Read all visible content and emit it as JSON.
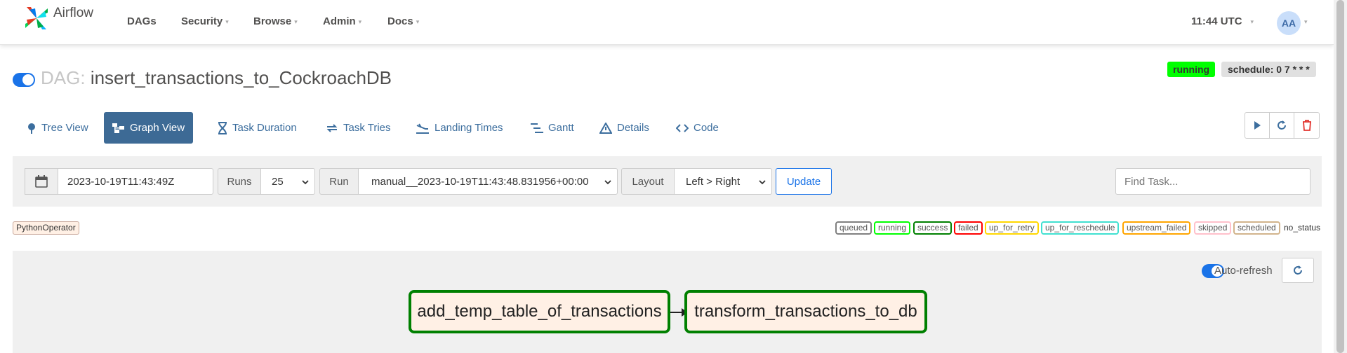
{
  "navbar": {
    "brand": "Airflow",
    "items": [
      "DAGs",
      "Security",
      "Browse",
      "Admin",
      "Docs"
    ],
    "time": "11:44 UTC",
    "avatar": "AA"
  },
  "dag": {
    "prefix": "DAG:",
    "name": "insert_transactions_to_CockroachDB",
    "status": "running",
    "schedule": "schedule: 0 7 * * *"
  },
  "tabs": [
    "Tree View",
    "Graph View",
    "Task Duration",
    "Task Tries",
    "Landing Times",
    "Gantt",
    "Details",
    "Code"
  ],
  "active_tab": "Graph View",
  "controls": {
    "base_date": "2023-10-19T11:43:49Z",
    "runs_label": "Runs",
    "runs_value": "25",
    "run_label": "Run",
    "run_value": "manual__2023-10-19T11:43:48.831956+00:00",
    "layout_label": "Layout",
    "layout_value": "Left > Right",
    "update_label": "Update",
    "find_placeholder": "Find Task..."
  },
  "legend": {
    "operator": "PythonOperator",
    "states": [
      {
        "label": "queued",
        "color": "#808080"
      },
      {
        "label": "running",
        "color": "#00ff00"
      },
      {
        "label": "success",
        "color": "#008000"
      },
      {
        "label": "failed",
        "color": "#ff0000"
      },
      {
        "label": "up_for_retry",
        "color": "#ffd700"
      },
      {
        "label": "up_for_reschedule",
        "color": "#40e0d0"
      },
      {
        "label": "upstream_failed",
        "color": "#ffa500"
      },
      {
        "label": "skipped",
        "color": "#ffc0cb"
      },
      {
        "label": "scheduled",
        "color": "#d2b48c"
      }
    ],
    "no_status": "no_status"
  },
  "graph": {
    "auto_refresh_label": "Auto-refresh",
    "nodes": [
      "add_temp_table_of_transactions",
      "transform_transactions_to_db"
    ],
    "node_state_color": "#008000"
  }
}
